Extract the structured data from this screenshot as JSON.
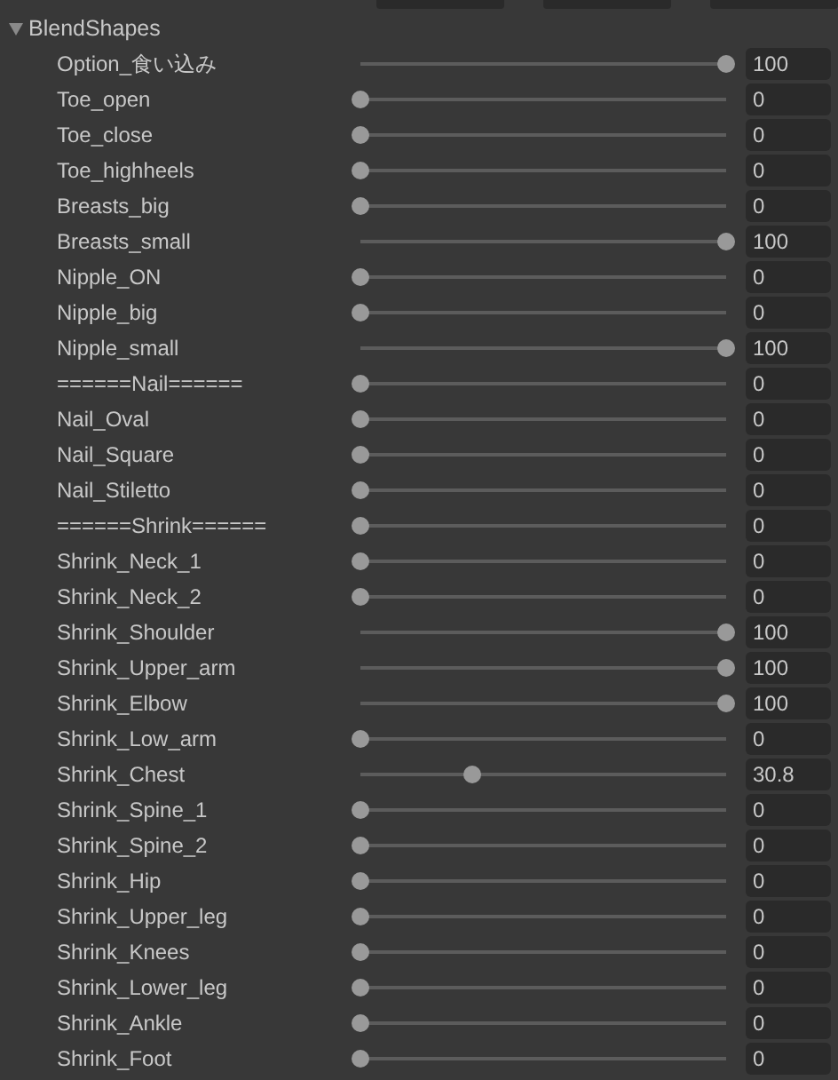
{
  "blend_shapes": {
    "title": "BlendShapes",
    "expanded": true,
    "items": [
      {
        "name": "Option_食い込み",
        "level": 1,
        "value": "100"
      },
      {
        "name": "Toe_open",
        "level": 0,
        "value": "0"
      },
      {
        "name": "Toe_close",
        "level": 0,
        "value": "0"
      },
      {
        "name": "Toe_highheels",
        "level": 0,
        "value": "0"
      },
      {
        "name": "Breasts_big",
        "level": 0,
        "value": "0"
      },
      {
        "name": "Breasts_small",
        "level": 1,
        "value": "100"
      },
      {
        "name": "Nipple_ON",
        "level": 0,
        "value": "0"
      },
      {
        "name": "Nipple_big",
        "level": 0,
        "value": "0"
      },
      {
        "name": "Nipple_small",
        "level": 1,
        "value": "100"
      },
      {
        "name": "======Nail======",
        "level": 0,
        "value": "0"
      },
      {
        "name": "Nail_Oval",
        "level": 0,
        "value": "0"
      },
      {
        "name": "Nail_Square",
        "level": 0,
        "value": "0"
      },
      {
        "name": "Nail_Stiletto",
        "level": 0,
        "value": "0"
      },
      {
        "name": "======Shrink======",
        "level": 0,
        "value": "0"
      },
      {
        "name": "Shrink_Neck_1",
        "level": 0,
        "value": "0"
      },
      {
        "name": "Shrink_Neck_2",
        "level": 0,
        "value": "0"
      },
      {
        "name": "Shrink_Shoulder",
        "level": 1,
        "value": "100"
      },
      {
        "name": "Shrink_Upper_arm",
        "level": 1,
        "value": "100"
      },
      {
        "name": "Shrink_Elbow",
        "level": 1,
        "value": "100"
      },
      {
        "name": "Shrink_Low_arm",
        "level": 0,
        "value": "0"
      },
      {
        "name": "Shrink_Chest",
        "level": 0.308,
        "value": "30.8"
      },
      {
        "name": "Shrink_Spine_1",
        "level": 0,
        "value": "0"
      },
      {
        "name": "Shrink_Spine_2",
        "level": 0,
        "value": "0"
      },
      {
        "name": "Shrink_Hip",
        "level": 0,
        "value": "0"
      },
      {
        "name": "Shrink_Upper_leg",
        "level": 0,
        "value": "0"
      },
      {
        "name": "Shrink_Knees",
        "level": 0,
        "value": "0"
      },
      {
        "name": "Shrink_Lower_leg",
        "level": 0,
        "value": "0"
      },
      {
        "name": "Shrink_Ankle",
        "level": 0,
        "value": "0"
      },
      {
        "name": "Shrink_Foot",
        "level": 0,
        "value": "0"
      }
    ]
  }
}
